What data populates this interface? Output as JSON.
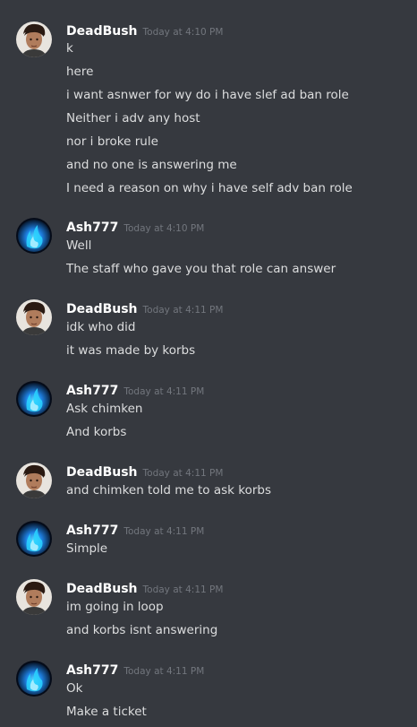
{
  "colors": {
    "background": "#36393f",
    "username": "#ffffff",
    "timestamp": "#72767d",
    "message_text": "#dcddde"
  },
  "icons": {
    "deadbush_avatar": "person-photo-avatar",
    "ash_avatar": "blue-flame-avatar"
  },
  "messages": [
    {
      "author": "DeadBush",
      "timestamp": "Today at 4:10 PM",
      "lines": [
        "k",
        "here",
        "i want asnwer for wy do i have slef ad ban role",
        "Neither i adv any host",
        "nor i broke rule",
        "and no one is answering me",
        "I need a reason on why i have self adv ban role"
      ]
    },
    {
      "author": "Ash777",
      "timestamp": "Today at 4:10 PM",
      "lines": [
        "Well",
        "The staff who gave you that role can answer"
      ]
    },
    {
      "author": "DeadBush",
      "timestamp": "Today at 4:11 PM",
      "lines": [
        "idk who did",
        "it was made by korbs"
      ]
    },
    {
      "author": "Ash777",
      "timestamp": "Today at 4:11 PM",
      "lines": [
        "Ask chimken",
        "And korbs"
      ]
    },
    {
      "author": "DeadBush",
      "timestamp": "Today at 4:11 PM",
      "lines": [
        "and chimken told me to ask korbs"
      ]
    },
    {
      "author": "Ash777",
      "timestamp": "Today at 4:11 PM",
      "lines": [
        "Simple"
      ]
    },
    {
      "author": "DeadBush",
      "timestamp": "Today at 4:11 PM",
      "lines": [
        "im going in loop",
        "and korbs isnt answering"
      ]
    },
    {
      "author": "Ash777",
      "timestamp": "Today at 4:11 PM",
      "lines": [
        "Ok",
        "Make a ticket"
      ]
    }
  ]
}
